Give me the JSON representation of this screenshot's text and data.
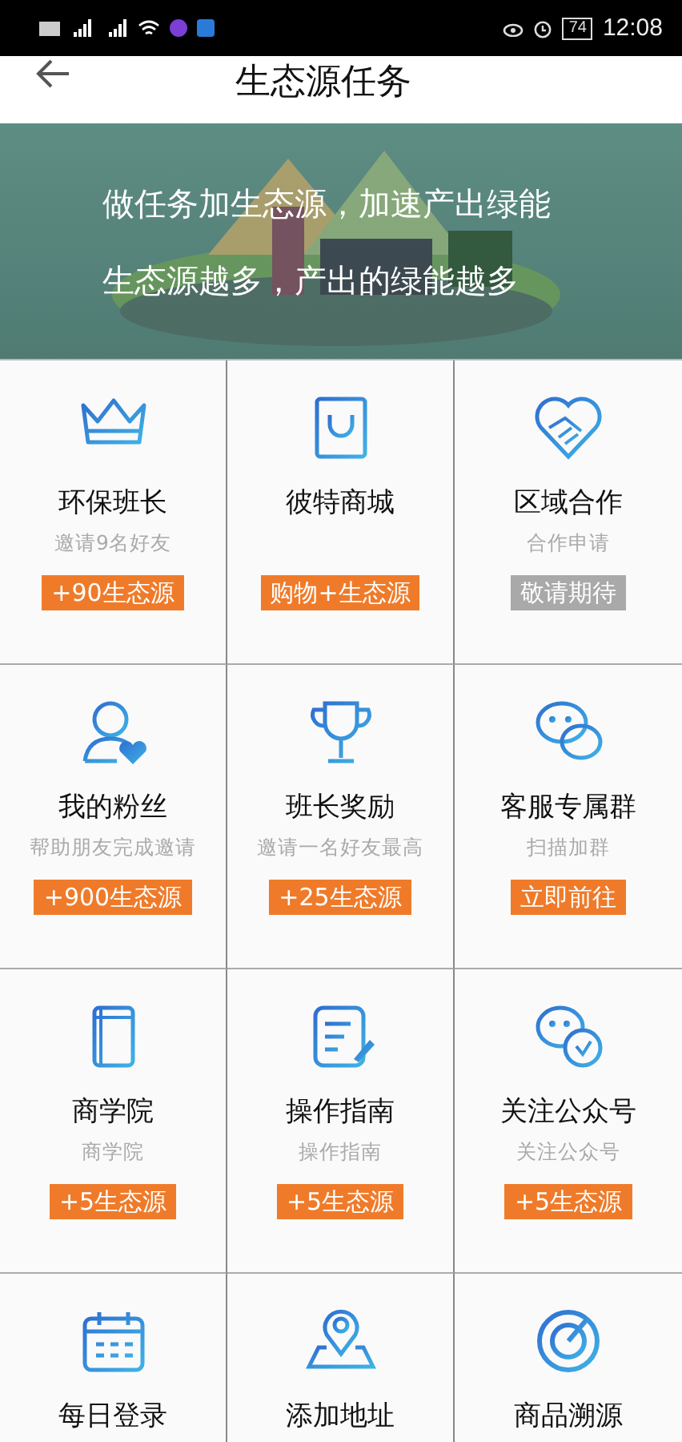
{
  "status_bar": {
    "battery": "74",
    "time": "12:08"
  },
  "header": {
    "title": "生态源任务"
  },
  "banner": {
    "lines": [
      "做任务加生态源，加速产出绿能",
      "生态源越多，产出的绿能越多"
    ]
  },
  "tasks": [
    {
      "title": "环保班长",
      "subtitle": "邀请9名好友",
      "badge": {
        "label": "+90生态源",
        "disabled": false
      }
    },
    {
      "title": "彼特商城",
      "badge": {
        "label": "购物+生态源",
        "disabled": false
      }
    },
    {
      "title": "区域合作",
      "subtitle": "合作申请",
      "badge": {
        "label": "敬请期待",
        "disabled": true
      }
    },
    {
      "title": "我的粉丝",
      "subtitle": "帮助朋友完成邀请",
      "badge": {
        "label": "+900生态源",
        "disabled": false
      }
    },
    {
      "title": "班长奖励",
      "subtitle": "邀请一名好友最高",
      "badge": {
        "label": "+25生态源",
        "disabled": false
      }
    },
    {
      "title": "客服专属群",
      "subtitle": "扫描加群",
      "badge": {
        "label": "立即前往",
        "disabled": false
      }
    },
    {
      "title": "商学院",
      "subtitle": "商学院",
      "badge": {
        "label": "+5生态源",
        "disabled": false
      }
    },
    {
      "title": "操作指南",
      "subtitle": "操作指南",
      "badge": {
        "label": "+5生态源",
        "disabled": false
      }
    },
    {
      "title": "关注公众号",
      "subtitle": "关注公众号",
      "badge": {
        "label": "+5生态源",
        "disabled": false
      }
    },
    {
      "title": "每日登录"
    },
    {
      "title": "添加地址"
    },
    {
      "title": "商品溯源"
    }
  ]
}
